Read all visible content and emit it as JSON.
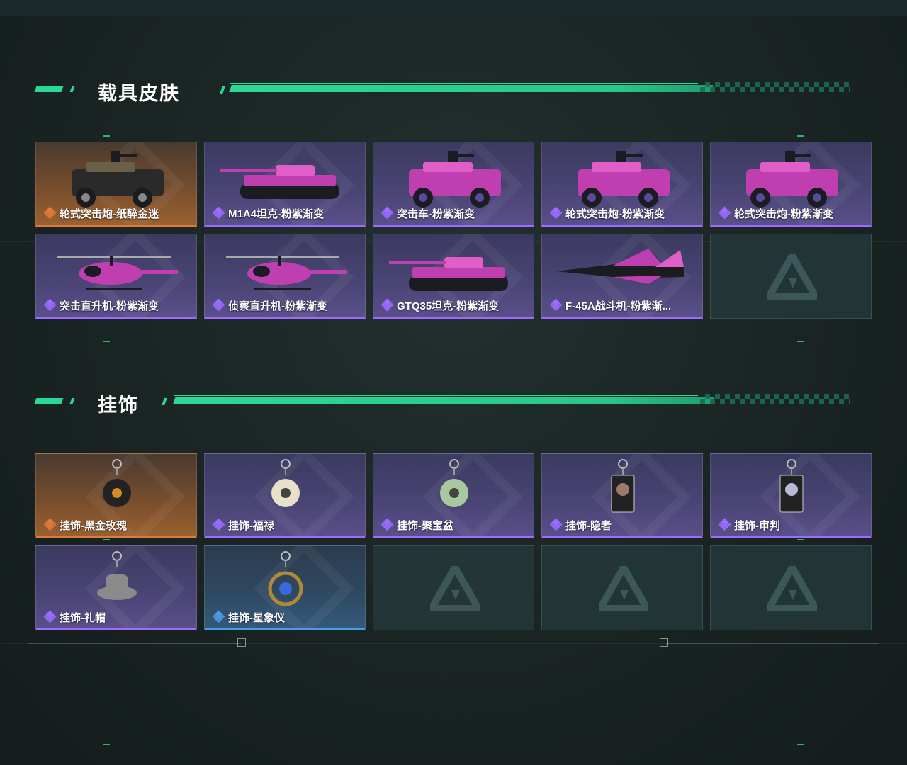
{
  "sections": {
    "vehicle_skins": {
      "title": "载具皮肤",
      "items": [
        {
          "label": "轮式突击炮-纸醉金迷",
          "rarity": "orange",
          "icon": "armored-car-icon"
        },
        {
          "label": "M1A4坦克-粉紫渐变",
          "rarity": "purple",
          "icon": "tank-icon"
        },
        {
          "label": "突击车-粉紫渐变",
          "rarity": "purple",
          "icon": "assault-vehicle-icon"
        },
        {
          "label": "轮式突击炮-粉紫渐变",
          "rarity": "purple",
          "icon": "armored-car-icon"
        },
        {
          "label": "轮式突击炮-粉紫渐变",
          "rarity": "purple",
          "icon": "armored-car-icon"
        },
        {
          "label": "突击直升机-粉紫渐变",
          "rarity": "purple",
          "icon": "attack-helicopter-icon"
        },
        {
          "label": "侦察直升机-粉紫渐变",
          "rarity": "purple",
          "icon": "scout-helicopter-icon"
        },
        {
          "label": "GTQ35坦克-粉紫渐变",
          "rarity": "purple",
          "icon": "tank-icon"
        },
        {
          "label": "F-45A战斗机-粉紫渐...",
          "rarity": "purple",
          "icon": "fighter-jet-icon"
        }
      ]
    },
    "charms": {
      "title": "挂饰",
      "items": [
        {
          "label": "挂饰-黑金玫瑰",
          "rarity": "orange",
          "icon": "rose-charm-icon"
        },
        {
          "label": "挂饰-福禄",
          "rarity": "purple",
          "icon": "panda-charm-icon"
        },
        {
          "label": "挂饰-聚宝盆",
          "rarity": "purple",
          "icon": "treasure-bowl-charm-icon"
        },
        {
          "label": "挂饰-隐者",
          "rarity": "purple",
          "icon": "hermit-card-charm-icon"
        },
        {
          "label": "挂饰-审判",
          "rarity": "purple",
          "icon": "judgement-card-charm-icon"
        },
        {
          "label": "挂饰-礼帽",
          "rarity": "purple",
          "icon": "hat-charm-icon"
        },
        {
          "label": "挂饰-星象仪",
          "rarity": "blue",
          "icon": "astrolabe-charm-icon"
        }
      ]
    }
  },
  "colors": {
    "accent_green": "#2bd997",
    "rarity_orange": "#e07a38",
    "rarity_purple": "#9b6cff",
    "rarity_blue": "#4d9be6"
  }
}
